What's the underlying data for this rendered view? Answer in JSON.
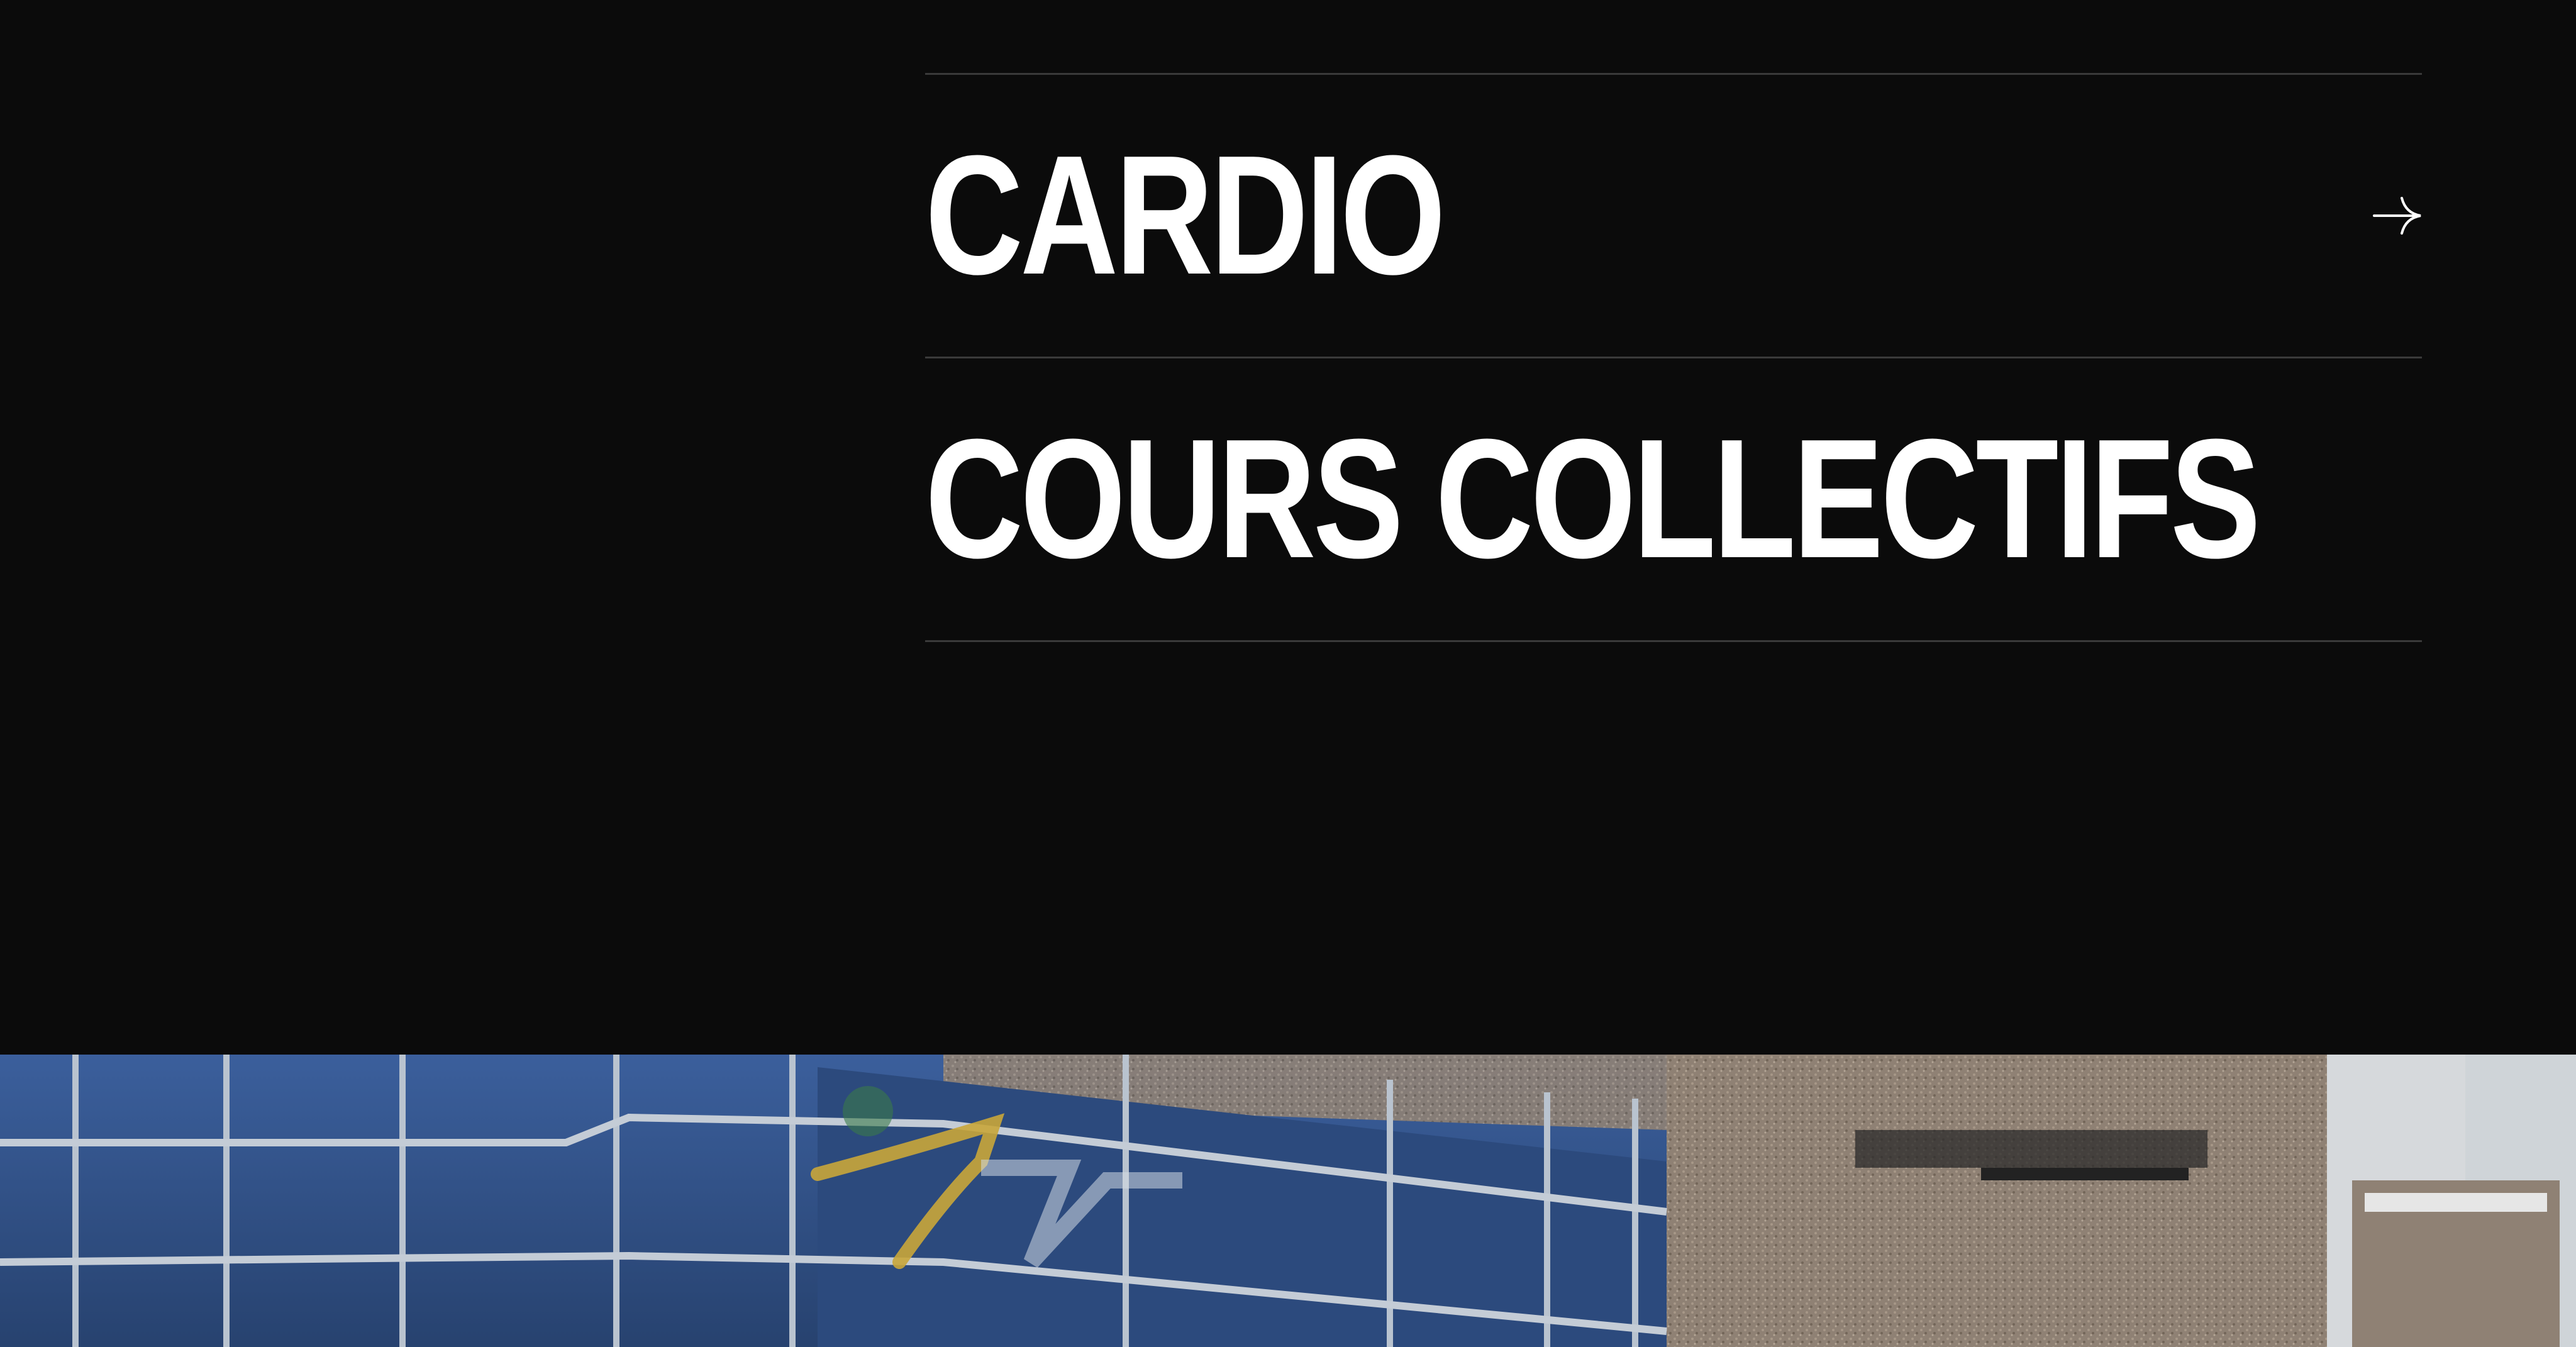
{
  "menu": {
    "items": [
      {
        "label": "CARDIO",
        "icon": "arrow-right-icon"
      },
      {
        "label": "COURS COLLECTIFS",
        "icon": "arrow-right-icon"
      }
    ]
  },
  "hero": {
    "image": "gym-building-facade-photo"
  },
  "colors": {
    "background": "#0b0b0b",
    "text": "#ffffff",
    "divider": "#3a3a3a"
  }
}
